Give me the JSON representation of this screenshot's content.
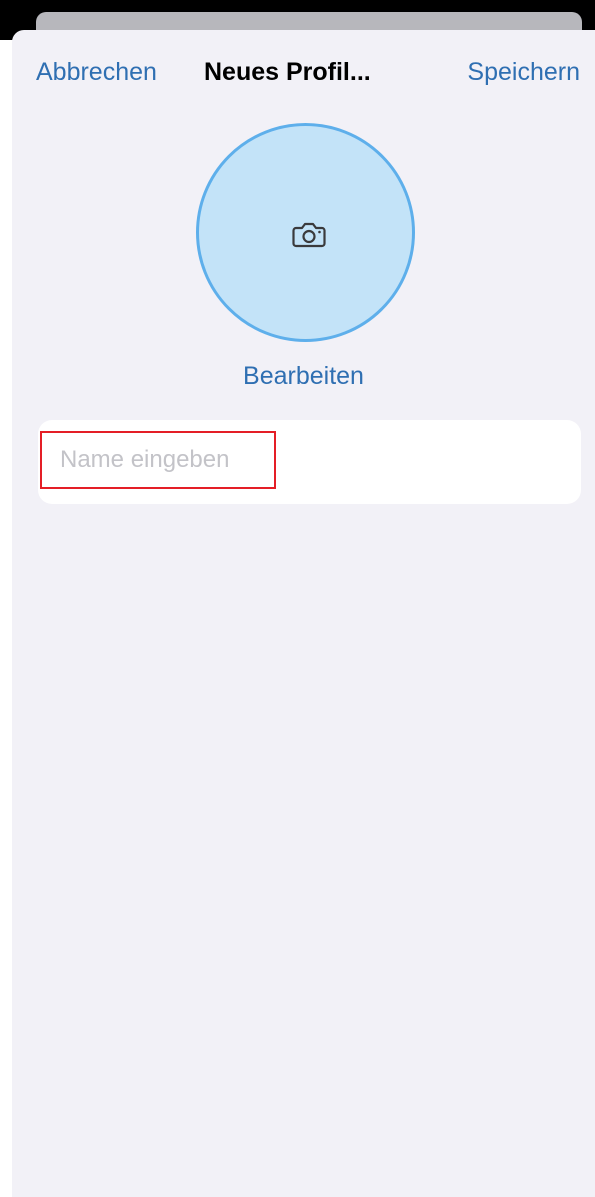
{
  "navigation": {
    "cancel_label": "Abbrechen",
    "title": "Neues Profil...",
    "save_label": "Speichern"
  },
  "avatar": {
    "icon": "camera-icon",
    "edit_label": "Bearbeiten"
  },
  "name_field": {
    "value": "",
    "placeholder": "Name eingeben"
  },
  "colors": {
    "accent": "#2f6fb2",
    "avatar_fill": "#c3e3f8",
    "avatar_border": "#5eafeb",
    "highlight_border": "#e41e26",
    "sheet_background": "#f2f1f7"
  }
}
